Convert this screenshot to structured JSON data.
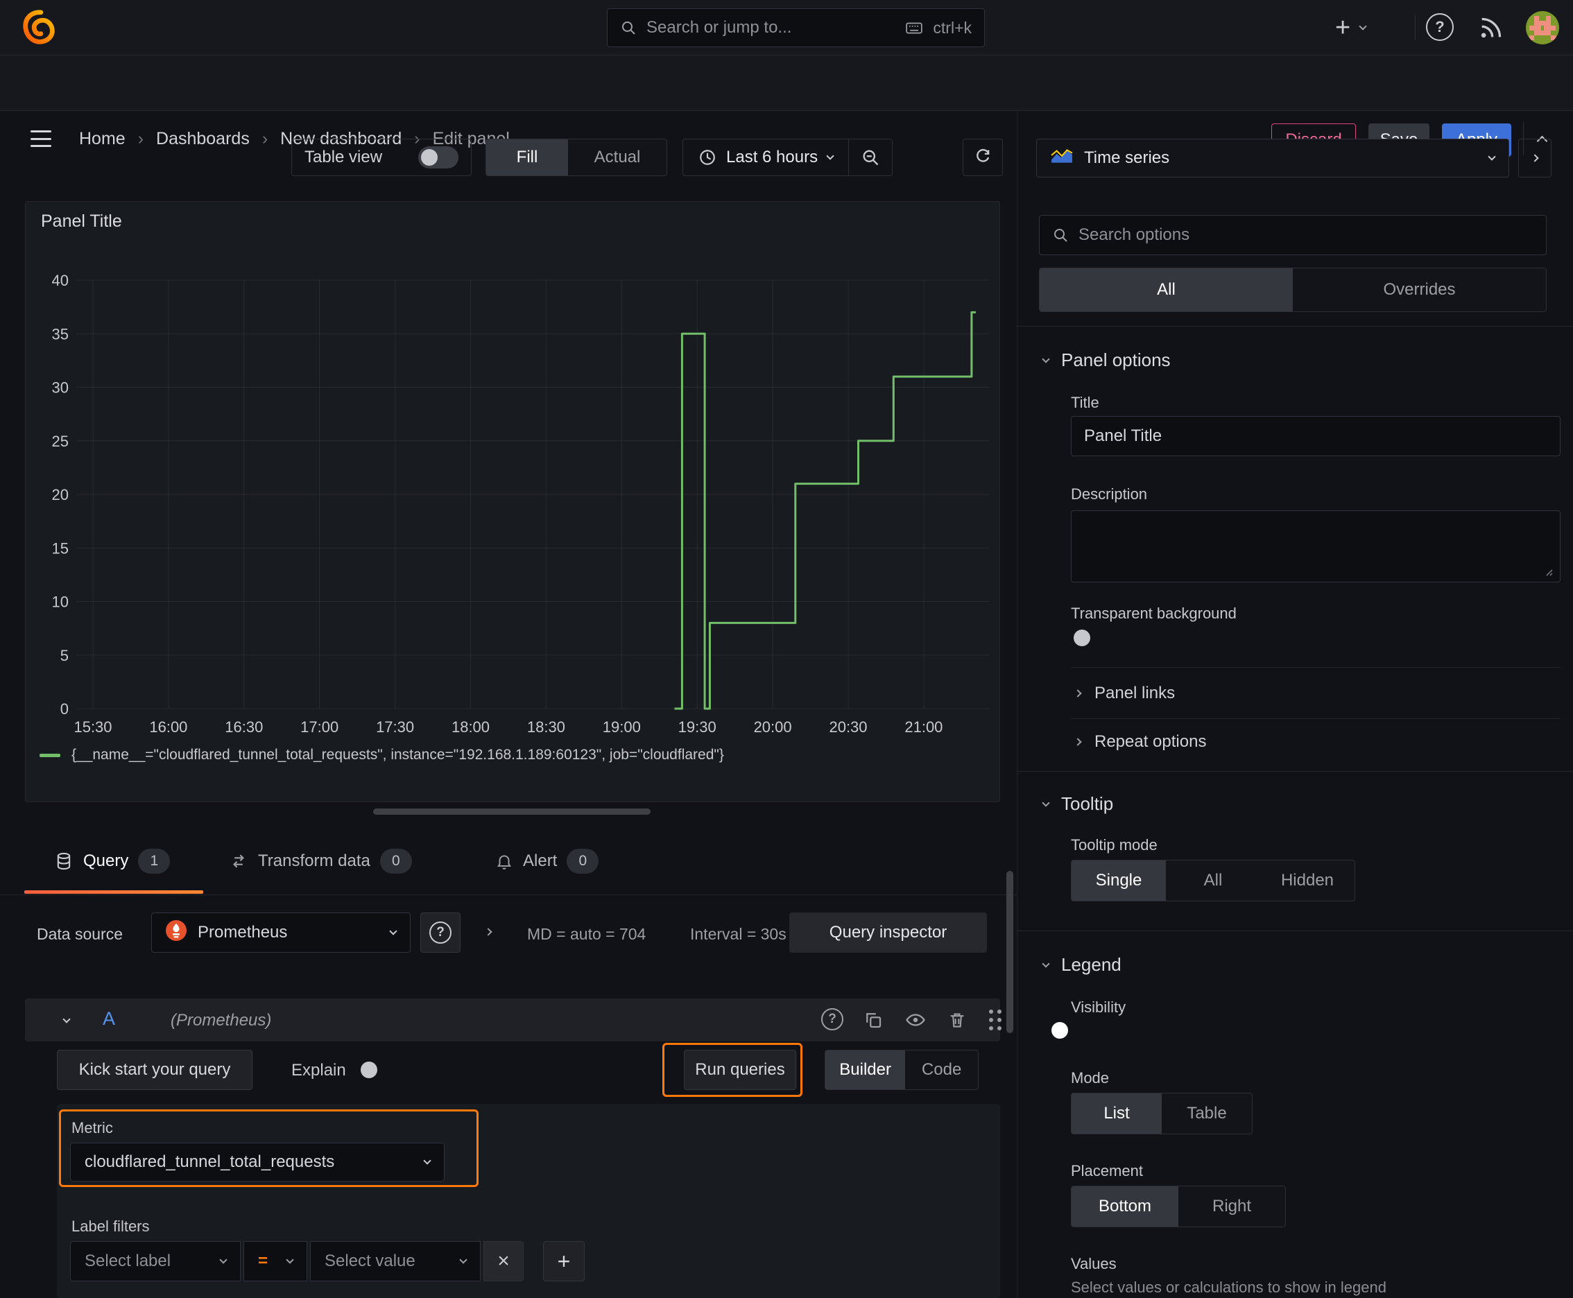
{
  "icons": {
    "plus": "+",
    "question": "?",
    "close": "×"
  },
  "topnav": {
    "search_placeholder": "Search or jump to...",
    "search_shortcut": "ctrl+k"
  },
  "breadcrumb": {
    "items": [
      "Home",
      "Dashboards",
      "New dashboard",
      "Edit panel"
    ],
    "discard_label": "Discard",
    "save_label": "Save",
    "apply_label": "Apply"
  },
  "toolbar": {
    "table_view_label": "Table view",
    "fill_label": "Fill",
    "actual_label": "Actual",
    "time_range_label": "Last 6 hours"
  },
  "panel": {
    "title": "Panel Title"
  },
  "chart_data": {
    "type": "line",
    "render": "step-after",
    "title": "Panel Title",
    "x_ticks": [
      "15:30",
      "16:00",
      "16:30",
      "17:00",
      "17:30",
      "18:00",
      "18:30",
      "19:00",
      "19:30",
      "20:00",
      "20:30",
      "21:00"
    ],
    "y_ticks": [
      0,
      5,
      10,
      15,
      20,
      25,
      30,
      35,
      40
    ],
    "ylim": [
      0,
      40
    ],
    "x_range": [
      "15:24",
      "21:26"
    ],
    "grid": true,
    "legend_position": "bottom",
    "series": [
      {
        "name": "{__name__=\"cloudflared_tunnel_total_requests\", instance=\"192.168.1.189:60123\", job=\"cloudflared\"}",
        "color": "#73bf69",
        "points": [
          [
            "19:21",
            0
          ],
          [
            "19:24",
            35
          ],
          [
            "19:33",
            0
          ],
          [
            "19:35",
            8
          ],
          [
            "20:09",
            21
          ],
          [
            "20:34",
            25
          ],
          [
            "20:48",
            31
          ],
          [
            "21:19",
            37
          ]
        ]
      }
    ]
  },
  "query_tabs": {
    "query_label": "Query",
    "query_count": "1",
    "transform_label": "Transform data",
    "transform_count": "0",
    "alert_label": "Alert",
    "alert_count": "0"
  },
  "datasource": {
    "label": "Data source",
    "name": "Prometheus",
    "md_text": "MD = auto = 704",
    "interval_text": "Interval = 30s",
    "inspector_label": "Query inspector"
  },
  "query_editor": {
    "ref_id": "A",
    "ds_hint": "(Prometheus)",
    "kick_start_label": "Kick start your query",
    "explain_label": "Explain",
    "run_queries_label": "Run queries",
    "builder_label": "Builder",
    "code_label": "Code",
    "metric_label": "Metric",
    "metric_value": "cloudflared_tunnel_total_requests",
    "label_filters_label": "Label filters",
    "select_label_placeholder": "Select label",
    "op": "=",
    "select_value_placeholder": "Select value"
  },
  "options": {
    "viz_name": "Time series",
    "search_placeholder": "Search options",
    "tab_all": "All",
    "tab_overrides": "Overrides",
    "panel_options": {
      "title": "Panel options",
      "title_label": "Title",
      "title_value": "Panel Title",
      "description_label": "Description",
      "transparent_label": "Transparent background"
    },
    "panel_links_label": "Panel links",
    "repeat_options_label": "Repeat options",
    "tooltip": {
      "title": "Tooltip",
      "mode_label": "Tooltip mode",
      "modes": [
        "Single",
        "All",
        "Hidden"
      ]
    },
    "legend": {
      "title": "Legend",
      "visibility_label": "Visibility",
      "mode_label": "Mode",
      "modes": [
        "List",
        "Table"
      ],
      "placement_label": "Placement",
      "placements": [
        "Bottom",
        "Right"
      ],
      "values_label": "Values",
      "values_hint": "Select values or calculations to show in legend"
    }
  },
  "colors": {
    "accent_orange": "#ff780a",
    "primary_blue": "#3d71d9",
    "series_green": "#73bf69",
    "danger_pink": "#e0457b"
  }
}
